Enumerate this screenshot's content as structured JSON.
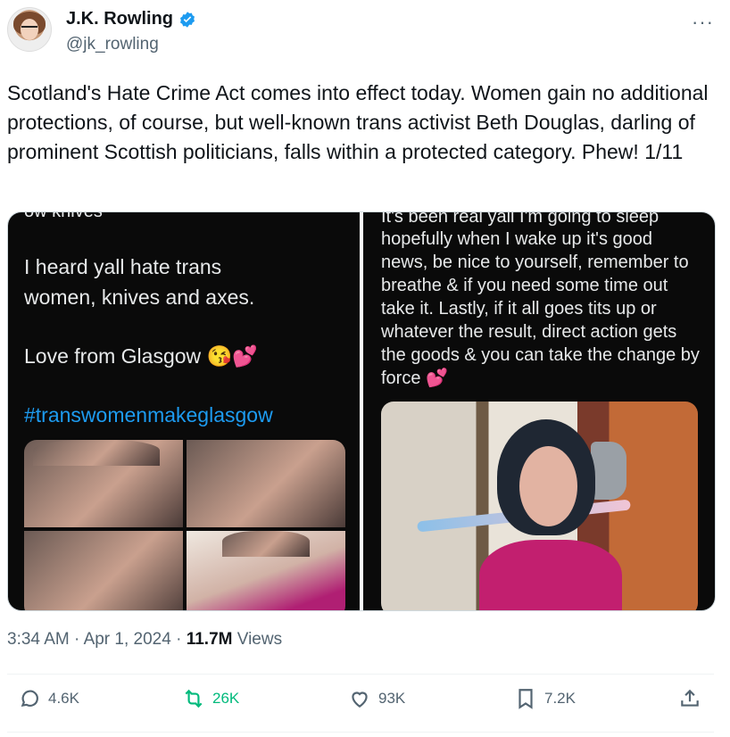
{
  "author": {
    "name": "J.K. Rowling",
    "handle": "@jk_rowling",
    "verified": true
  },
  "tweet": {
    "text": "Scotland's Hate Crime Act comes into effect today. Women gain no additional protections, of course, but well-known trans activist Beth Douglas, darling of prominent Scottish politicians, falls within a protected category. Phew! 1/11"
  },
  "media": {
    "left": {
      "top_cut": "ow knives",
      "line1": "I heard yall hate trans",
      "line2": "women, knives and axes.",
      "line3": "Love from Glasgow",
      "emoji": "😘💕",
      "hashtag": "#transwomenmakeglasgow"
    },
    "right": {
      "top_cut": "It's been real yall I'm going to sleep",
      "text": "hopefully when I wake up it's good news, be nice to yourself, remember to breathe & if you need some time out take it. Lastly, if it all goes tits up or whatever the result, direct action gets the goods & you can take the change by force",
      "emoji": "💕"
    }
  },
  "meta": {
    "time": "3:34 AM",
    "sep1": "·",
    "date": "Apr 1, 2024",
    "sep2": "·",
    "views_count": "11.7M",
    "views_label": "Views"
  },
  "actions": {
    "replies": "4.6K",
    "retweets": "26K",
    "likes": "93K",
    "bookmarks": "7.2K"
  },
  "colors": {
    "accent": "#1d9bf0",
    "retweet": "#00ba7c",
    "secondary_text": "#536471"
  }
}
